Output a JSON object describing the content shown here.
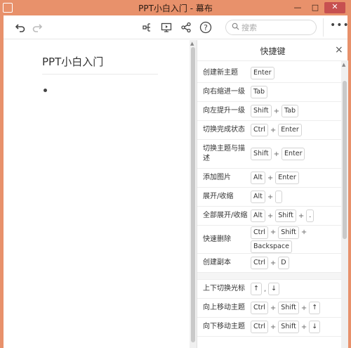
{
  "window": {
    "title": "PPT小白入门 - 幕布",
    "minimize": "—",
    "maximize": "□",
    "close": "✕"
  },
  "toolbar": {
    "search_placeholder": "搜索",
    "more": "•••"
  },
  "editor": {
    "doc_title": "PPT小白入门"
  },
  "panel": {
    "title": "快捷键",
    "close": "×",
    "rows": [
      {
        "label": "创建新主题",
        "keys": [
          "Enter"
        ],
        "h": 27
      },
      {
        "label": "向右缩进一级",
        "keys": [
          "Tab"
        ],
        "h": 27
      },
      {
        "label": "向左提升一级",
        "keys": [
          "Shift",
          "Tab"
        ],
        "h": 27
      },
      {
        "label": "切换完成状态",
        "keys": [
          "Ctrl",
          "Enter"
        ],
        "h": 27
      },
      {
        "label": "切换主题与描述",
        "keys": [
          "Shift",
          "Enter"
        ],
        "h": 41
      },
      {
        "label": "添加图片",
        "keys": [
          "Alt",
          "Enter"
        ],
        "h": 27
      },
      {
        "label": "展开/收缩",
        "keys": [
          "Alt",
          ""
        ],
        "h": 27
      },
      {
        "label": "全部展开/收缩",
        "keys": [
          "Alt",
          "Shift",
          "."
        ],
        "h": 27
      },
      {
        "label": "快速删除",
        "keys": [
          "Ctrl",
          "Shift",
          "Backspace"
        ],
        "h": 40
      },
      {
        "label": "创建副本",
        "keys": [
          "Ctrl",
          "D"
        ],
        "h": 27
      }
    ],
    "rows2": [
      {
        "label": "上下切换光标",
        "keys": [
          "↑",
          "↓"
        ],
        "sep": ",",
        "h": 27
      },
      {
        "label": "向上移动主题",
        "keys": [
          "Ctrl",
          "Shift",
          "↑"
        ],
        "h": 27
      },
      {
        "label": "向下移动主题",
        "keys": [
          "Ctrl",
          "Shift",
          "↓"
        ],
        "h": 27
      }
    ]
  },
  "colors": {
    "window_bg": "#E8916B",
    "close_btn": "#C75050"
  }
}
